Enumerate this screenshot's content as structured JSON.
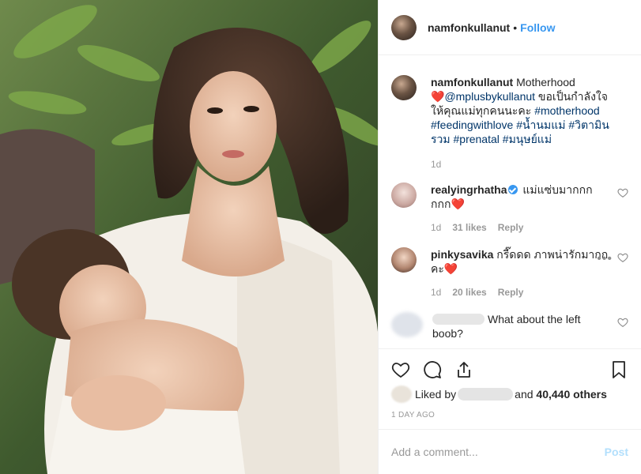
{
  "header": {
    "username": "namfonkullanut",
    "separator": "•",
    "follow_label": "Follow"
  },
  "caption": {
    "username": "namfonkullanut",
    "text_intro": " Motherhood",
    "heart": "❤️",
    "mention": "@mplusbykullanut",
    "text_thai": " ขอเป็นกำลังใจให้คุณแม่ทุกคนนะคะ ",
    "tags": [
      "#motherhood",
      "#feedingwithlove",
      "#น้ำนมแม่",
      "#วิตามินรวม",
      "#prenatal",
      "#มนุษย์แม่"
    ],
    "time": "1d"
  },
  "comments": [
    {
      "username": "realyingrhatha",
      "text": " แม่แซ่บมากกกกกก",
      "heart": "❤️",
      "time": "1d",
      "likes": "31 likes",
      "reply": "Reply"
    },
    {
      "username": "pinkysavika",
      "text": " กรี๊ดดด ภาพน่ารักมากกคะ",
      "heart": "❤️",
      "time": "1d",
      "likes": "20 likes",
      "reply": "Reply",
      "more": "•••"
    },
    {
      "text": "What about the left boob?"
    }
  ],
  "likes": {
    "prefix": "Liked by",
    "middle": "and",
    "count": "40,440 others"
  },
  "date": "1 DAY AGO",
  "add_comment": {
    "placeholder": "Add a comment...",
    "post_label": "Post"
  },
  "colors": {
    "link": "#3897f0",
    "hashtag": "#003569",
    "post_disabled": "#b2dffc",
    "meta": "#999999"
  },
  "icons": [
    "heart-icon",
    "comment-icon",
    "share-icon",
    "bookmark-icon",
    "verified-icon"
  ]
}
